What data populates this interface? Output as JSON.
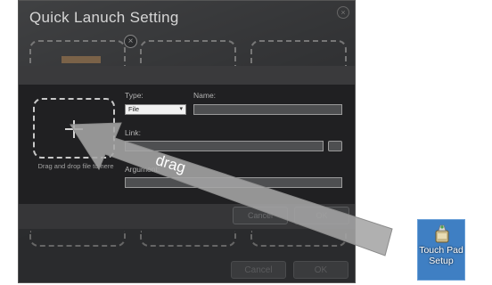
{
  "window": {
    "title": "Quick Lanuch Setting"
  },
  "background": {
    "cancel_label": "Cancel",
    "ok_label": "OK"
  },
  "dialog": {
    "drop_hint": "Drag and drop file to here",
    "type_label": "Type:",
    "type_value": "File",
    "name_label": "Name:",
    "link_label": "Link:",
    "argument_label": "Argument:",
    "cancel_label": "Cancel",
    "ok_label": "OK"
  },
  "annotation": {
    "drag_label": "drag"
  },
  "desktop_icon": {
    "line1": "Touch Pad",
    "line2": "Setup",
    "icon": "setup-icon"
  }
}
